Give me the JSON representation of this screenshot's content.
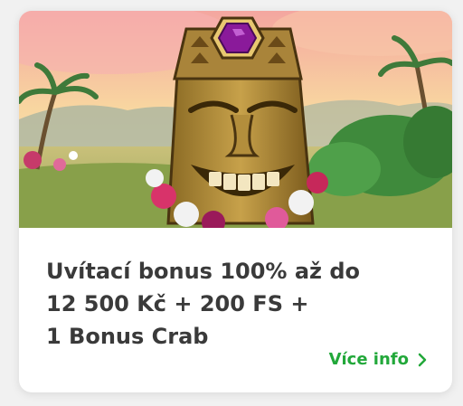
{
  "promo": {
    "image_alt": "Tiki totem mask character with purple gem on tropical island background",
    "title_lines": [
      "Uvítací bonus 100% až do",
      "12 500 Kč + 200 FS +",
      "1 Bonus Crab"
    ],
    "more_label": "Více info",
    "more_icon": "chevron-right-icon"
  },
  "colors": {
    "link": "#22a83a",
    "title": "#3a3a3a",
    "card": "#ffffff",
    "gem": "#8a1a9a"
  }
}
